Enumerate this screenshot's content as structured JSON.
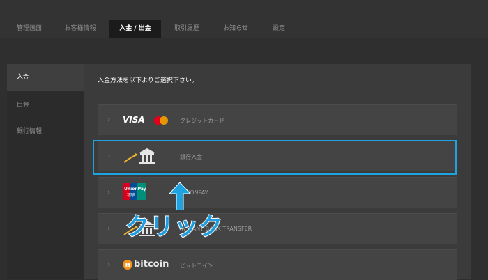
{
  "tabs": [
    {
      "label": "管理画面"
    },
    {
      "label": "お客様情報"
    },
    {
      "label": "入金 / 出金"
    },
    {
      "label": "取引履歴"
    },
    {
      "label": "お知らせ"
    },
    {
      "label": "設定"
    }
  ],
  "sidebar": {
    "items": [
      {
        "label": "入金"
      },
      {
        "label": "出金"
      },
      {
        "label": "銀行情報"
      }
    ]
  },
  "main": {
    "instruction": "入金方法を以下よりご選択下さい。",
    "methods": [
      {
        "logo_text": "VISA",
        "label": "クレジットカード"
      },
      {
        "label": "銀行入金"
      },
      {
        "logo_text": "UnionPay 银联",
        "label": "UNIONPAY"
      },
      {
        "label": "INSTANT BANK TRANSFER"
      },
      {
        "logo_text": "bitcoin",
        "label": "ビットコイン"
      }
    ]
  },
  "annotation": {
    "click_text": "クリック",
    "color": "#1da3e0"
  }
}
